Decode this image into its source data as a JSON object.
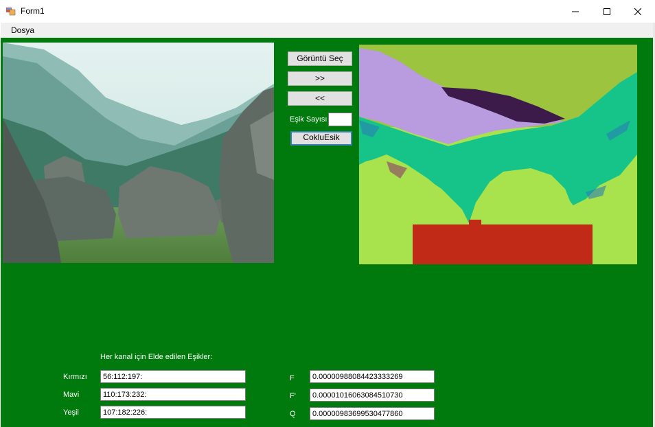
{
  "window": {
    "title": "Form1"
  },
  "menu": {
    "items": [
      "Dosya"
    ]
  },
  "buttons": {
    "select_image": "Görüntü Seç",
    "next": ">>",
    "prev": "<<",
    "multi_threshold": "CokluEsik"
  },
  "threshold_count": {
    "label": "Eşik Sayısı",
    "value": ""
  },
  "results": {
    "heading": "Her kanal için Elde edilen Eşikler:",
    "channels": [
      {
        "label": "Kırmızı",
        "value": "56:112:197:"
      },
      {
        "label": "Mavi",
        "value": "110:173:232:"
      },
      {
        "label": "Yeşil",
        "value": "107:182:226:"
      }
    ],
    "metrics": [
      {
        "label": "F",
        "value": "0.00000988084423333269"
      },
      {
        "label": "F'",
        "value": "0.00001016063084510730"
      },
      {
        "label": "Q",
        "value": "0.00000983699530477860"
      }
    ]
  },
  "colors": {
    "client_bg": "#007a0c",
    "accent": "#3c7fb1"
  }
}
